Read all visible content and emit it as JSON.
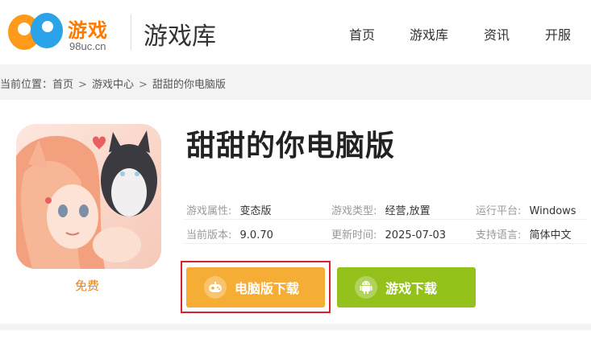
{
  "header": {
    "logo_text": "游戏",
    "logo_domain": "98uc.cn",
    "title": "游戏库",
    "nav": [
      "首页",
      "游戏库",
      "资讯",
      "开服"
    ]
  },
  "breadcrumb": {
    "prefix": "当前位置：",
    "items": [
      "首页",
      "游戏中心",
      "甜甜的你电脑版"
    ],
    "separator": ">"
  },
  "game": {
    "title": "甜甜的你电脑版",
    "price": "免费",
    "info": [
      {
        "label": "游戏属性:",
        "value": "变态版"
      },
      {
        "label": "游戏类型:",
        "value": "经营,放置"
      },
      {
        "label": "运行平台:",
        "value": "Windows"
      },
      {
        "label": "当前版本:",
        "value": "9.0.70"
      },
      {
        "label": "更新时间:",
        "value": "2025-07-03"
      },
      {
        "label": "支持语言:",
        "value": "简体中文"
      }
    ]
  },
  "buttons": {
    "pc_download": "电脑版下载",
    "game_download": "游戏下载"
  },
  "colors": {
    "accent_orange": "#f6ad35",
    "accent_green": "#94c11c",
    "highlight_red": "#d9232e",
    "price_orange": "#e8811a"
  },
  "icons": {
    "pc_button": "gamepad-icon",
    "game_button": "android-icon"
  }
}
